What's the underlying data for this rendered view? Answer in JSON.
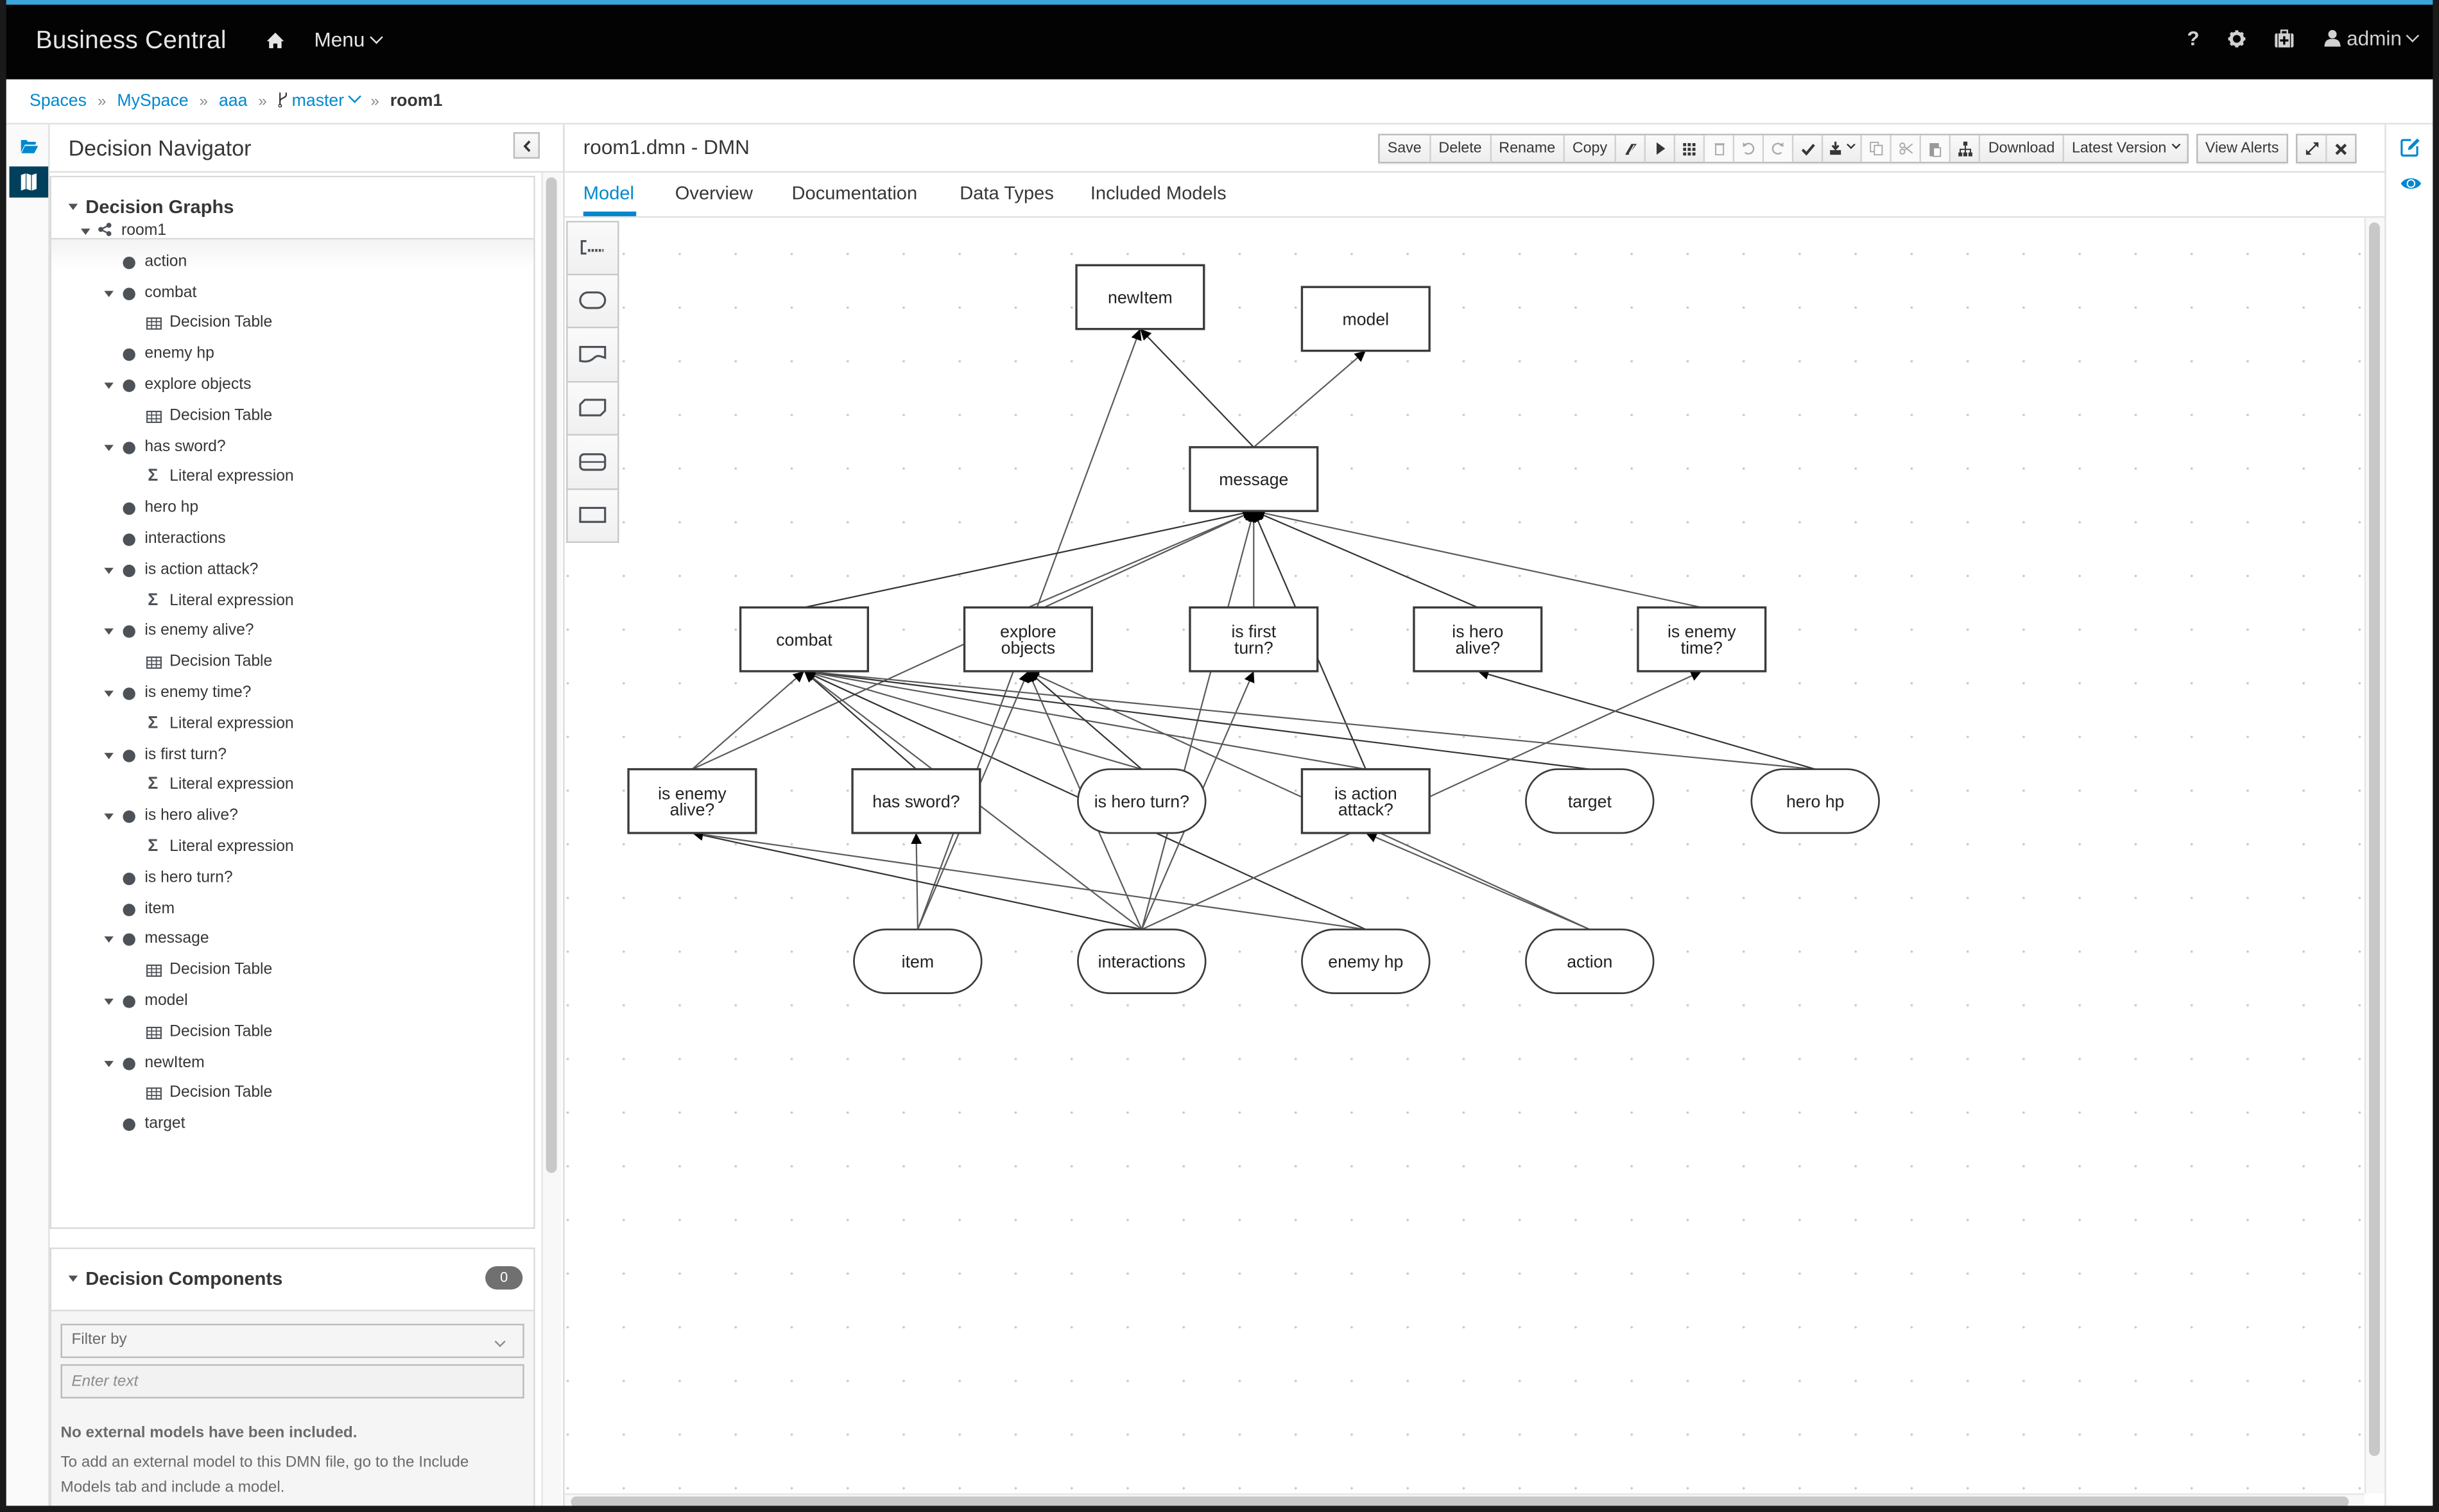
{
  "app": {
    "brand": "Business Central",
    "menu_label": "Menu",
    "user_label": "admin",
    "icons": [
      "home-icon",
      "help-icon",
      "gear-icon",
      "medkit-icon",
      "user-icon"
    ]
  },
  "breadcrumb": {
    "items": [
      "Spaces",
      "MySpace",
      "aaa"
    ],
    "branch": "master",
    "current": "room1"
  },
  "sidebar": {
    "title": "Decision Navigator",
    "graphs_title": "Decision Graphs",
    "root": "room1",
    "tree": [
      {
        "label": "action",
        "level": 1,
        "icon": "dot",
        "expanded": false
      },
      {
        "label": "combat",
        "level": 1,
        "icon": "dot",
        "expanded": true
      },
      {
        "label": "Decision Table",
        "level": 2,
        "icon": "table"
      },
      {
        "label": "enemy hp",
        "level": 1,
        "icon": "dot",
        "expanded": false
      },
      {
        "label": "explore objects",
        "level": 1,
        "icon": "dot",
        "expanded": true
      },
      {
        "label": "Decision Table",
        "level": 2,
        "icon": "table"
      },
      {
        "label": "has sword?",
        "level": 1,
        "icon": "dot",
        "expanded": true
      },
      {
        "label": "Literal expression",
        "level": 2,
        "icon": "sigma"
      },
      {
        "label": "hero hp",
        "level": 1,
        "icon": "dot",
        "expanded": false
      },
      {
        "label": "interactions",
        "level": 1,
        "icon": "dot",
        "expanded": false
      },
      {
        "label": "is action attack?",
        "level": 1,
        "icon": "dot",
        "expanded": true
      },
      {
        "label": "Literal expression",
        "level": 2,
        "icon": "sigma"
      },
      {
        "label": "is enemy alive?",
        "level": 1,
        "icon": "dot",
        "expanded": true
      },
      {
        "label": "Decision Table",
        "level": 2,
        "icon": "table"
      },
      {
        "label": "is enemy time?",
        "level": 1,
        "icon": "dot",
        "expanded": true
      },
      {
        "label": "Literal expression",
        "level": 2,
        "icon": "sigma"
      },
      {
        "label": "is first turn?",
        "level": 1,
        "icon": "dot",
        "expanded": true
      },
      {
        "label": "Literal expression",
        "level": 2,
        "icon": "sigma"
      },
      {
        "label": "is hero alive?",
        "level": 1,
        "icon": "dot",
        "expanded": true
      },
      {
        "label": "Literal expression",
        "level": 2,
        "icon": "sigma"
      },
      {
        "label": "is hero turn?",
        "level": 1,
        "icon": "dot",
        "expanded": false
      },
      {
        "label": "item",
        "level": 1,
        "icon": "dot",
        "expanded": false
      },
      {
        "label": "message",
        "level": 1,
        "icon": "dot",
        "expanded": true
      },
      {
        "label": "Decision Table",
        "level": 2,
        "icon": "table"
      },
      {
        "label": "model",
        "level": 1,
        "icon": "dot",
        "expanded": true
      },
      {
        "label": "Decision Table",
        "level": 2,
        "icon": "table"
      },
      {
        "label": "newItem",
        "level": 1,
        "icon": "dot",
        "expanded": true
      },
      {
        "label": "Decision Table",
        "level": 2,
        "icon": "table"
      },
      {
        "label": "target",
        "level": 1,
        "icon": "dot",
        "expanded": false
      }
    ],
    "components": {
      "title": "Decision Components",
      "count": "0",
      "filter_placeholder": "Filter by",
      "search_placeholder": "Enter text",
      "empty_title": "No external models have been included.",
      "empty_text": "To add an external model to this DMN file, go to the Include Models tab and include a model."
    }
  },
  "editor": {
    "title": "room1.dmn - DMN",
    "toolbar": {
      "save": "Save",
      "delete": "Delete",
      "rename": "Rename",
      "copy": "Copy",
      "download": "Download",
      "latest_version": "Latest Version",
      "view_alerts": "View Alerts"
    },
    "tabs": [
      "Model",
      "Overview",
      "Documentation",
      "Data Types",
      "Included Models"
    ],
    "active_tab": "Model",
    "palette": [
      "annotation-tool",
      "input-data-tool",
      "knowledge-source-tool",
      "bkm-tool",
      "decision-service-tool",
      "decision-tool"
    ]
  },
  "diagram": {
    "nodes": [
      {
        "id": "newItem",
        "label": "newItem",
        "type": "decision"
      },
      {
        "id": "model",
        "label": "model",
        "type": "decision"
      },
      {
        "id": "message",
        "label": "message",
        "type": "decision"
      },
      {
        "id": "combat",
        "label": "combat",
        "type": "decision"
      },
      {
        "id": "explore",
        "label": "explore objects",
        "type": "decision"
      },
      {
        "id": "firstturn",
        "label": "is first turn?",
        "type": "decision"
      },
      {
        "id": "heroalive",
        "label": "is hero alive?",
        "type": "decision"
      },
      {
        "id": "enemytime",
        "label": "is enemy time?",
        "type": "decision"
      },
      {
        "id": "enemyalive",
        "label": "is enemy alive?",
        "type": "decision"
      },
      {
        "id": "sword",
        "label": "has sword?",
        "type": "decision"
      },
      {
        "id": "heroturn",
        "label": "is hero turn?",
        "type": "input"
      },
      {
        "id": "attack",
        "label": "is action attack?",
        "type": "decision"
      },
      {
        "id": "target",
        "label": "target",
        "type": "input"
      },
      {
        "id": "herohp",
        "label": "hero hp",
        "type": "input"
      },
      {
        "id": "item",
        "label": "item",
        "type": "input"
      },
      {
        "id": "interactions",
        "label": "interactions",
        "type": "input"
      },
      {
        "id": "enemyhp",
        "label": "enemy hp",
        "type": "input"
      },
      {
        "id": "action",
        "label": "action",
        "type": "input"
      }
    ],
    "edges": [
      [
        "message",
        "newItem"
      ],
      [
        "message",
        "model"
      ],
      [
        "item",
        "newItem"
      ],
      [
        "combat",
        "message"
      ],
      [
        "explore",
        "message"
      ],
      [
        "firstturn",
        "message"
      ],
      [
        "heroalive",
        "message"
      ],
      [
        "enemytime",
        "message"
      ],
      [
        "enemyalive",
        "message"
      ],
      [
        "attack",
        "message"
      ],
      [
        "interactions",
        "message"
      ],
      [
        "enemyalive",
        "combat"
      ],
      [
        "sword",
        "combat"
      ],
      [
        "heroturn",
        "combat"
      ],
      [
        "attack",
        "combat"
      ],
      [
        "target",
        "combat"
      ],
      [
        "herohp",
        "combat"
      ],
      [
        "interactions",
        "combat"
      ],
      [
        "enemyhp",
        "combat"
      ],
      [
        "item",
        "explore"
      ],
      [
        "interactions",
        "explore"
      ],
      [
        "heroturn",
        "explore"
      ],
      [
        "action",
        "explore"
      ],
      [
        "interactions",
        "firstturn"
      ],
      [
        "herohp",
        "heroalive"
      ],
      [
        "interactions",
        "enemytime"
      ],
      [
        "item",
        "sword"
      ],
      [
        "interactions",
        "enemyalive"
      ],
      [
        "enemyhp",
        "enemyalive"
      ],
      [
        "action",
        "attack"
      ]
    ]
  }
}
